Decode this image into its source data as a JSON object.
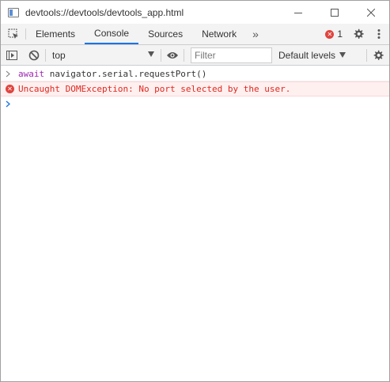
{
  "window": {
    "title": "devtools://devtools/devtools_app.html"
  },
  "tabs": [
    {
      "label": "Elements",
      "active": false
    },
    {
      "label": "Console",
      "active": true
    },
    {
      "label": "Sources",
      "active": false
    },
    {
      "label": "Network",
      "active": false
    }
  ],
  "tabbar": {
    "more": "»",
    "error_count": "1"
  },
  "toolbar": {
    "context": "top",
    "filter_placeholder": "Filter",
    "levels": "Default levels"
  },
  "console": {
    "input_keyword": "await",
    "input_code": " navigator.serial.requestPort()",
    "error_message": "Uncaught DOMException: No port selected by the user."
  },
  "colors": {
    "accent": "#1a73e8",
    "error": "#e0271e",
    "keyword": "#9c27b0"
  }
}
